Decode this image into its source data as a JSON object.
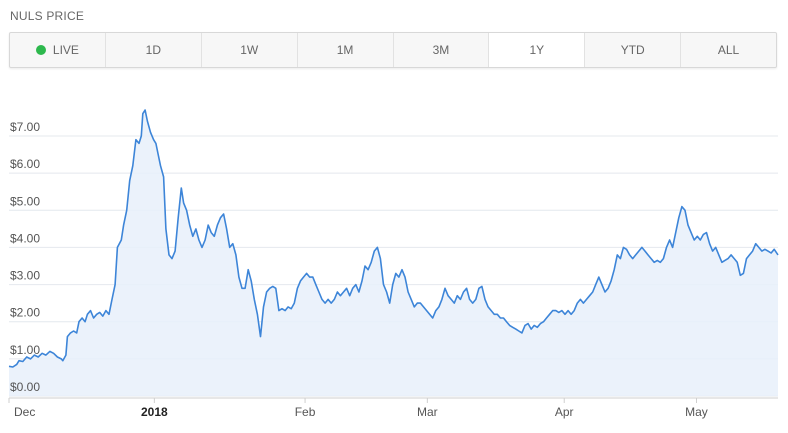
{
  "header": {
    "title": "NULS PRICE"
  },
  "range_buttons": [
    {
      "label": "LIVE",
      "has_dot": true
    },
    {
      "label": "1D"
    },
    {
      "label": "1W"
    },
    {
      "label": "1M"
    },
    {
      "label": "3M"
    },
    {
      "label": "1Y",
      "active": true
    },
    {
      "label": "YTD"
    },
    {
      "label": "ALL"
    }
  ],
  "colors": {
    "live_dot": "#2db84d",
    "line": "#3d85d8",
    "fill": "#e8f0fa",
    "grid": "#e4e8ee",
    "axis": "#cfcfcf"
  },
  "chart_data": {
    "type": "area",
    "title": "",
    "xlabel": "",
    "ylabel": "",
    "ylim": [
      0,
      8
    ],
    "grid": true,
    "yticks": [
      "$0.00",
      "$1.00",
      "$2.00",
      "$3.00",
      "$4.00",
      "$5.00",
      "$6.00",
      "$7.00"
    ],
    "ytick_values": [
      0,
      1,
      2,
      3,
      4,
      5,
      6,
      7
    ],
    "xticks": [
      {
        "label": "Dec",
        "t": 0.0,
        "bold": false
      },
      {
        "label": "2018",
        "t": 0.189,
        "bold": true
      },
      {
        "label": "Feb",
        "t": 0.385,
        "bold": false
      },
      {
        "label": "Mar",
        "t": 0.544,
        "bold": false
      },
      {
        "label": "Apr",
        "t": 0.722,
        "bold": false
      },
      {
        "label": "May",
        "t": 0.894,
        "bold": false
      }
    ],
    "series": [
      {
        "values": [
          [
            0.0,
            0.8
          ],
          [
            0.005,
            0.78
          ],
          [
            0.01,
            0.85
          ],
          [
            0.013,
            0.95
          ],
          [
            0.018,
            0.93
          ],
          [
            0.023,
            1.05
          ],
          [
            0.028,
            1.0
          ],
          [
            0.033,
            1.1
          ],
          [
            0.038,
            1.05
          ],
          [
            0.043,
            1.15
          ],
          [
            0.048,
            1.1
          ],
          [
            0.053,
            1.2
          ],
          [
            0.058,
            1.15
          ],
          [
            0.063,
            1.05
          ],
          [
            0.068,
            1.0
          ],
          [
            0.07,
            0.95
          ],
          [
            0.074,
            1.1
          ],
          [
            0.076,
            1.6
          ],
          [
            0.08,
            1.7
          ],
          [
            0.084,
            1.75
          ],
          [
            0.088,
            1.7
          ],
          [
            0.091,
            2.0
          ],
          [
            0.095,
            2.1
          ],
          [
            0.099,
            2.0
          ],
          [
            0.102,
            2.2
          ],
          [
            0.106,
            2.3
          ],
          [
            0.11,
            2.1
          ],
          [
            0.114,
            2.2
          ],
          [
            0.118,
            2.25
          ],
          [
            0.122,
            2.15
          ],
          [
            0.126,
            2.3
          ],
          [
            0.13,
            2.2
          ],
          [
            0.134,
            2.6
          ],
          [
            0.138,
            3.0
          ],
          [
            0.141,
            4.0
          ],
          [
            0.146,
            4.2
          ],
          [
            0.149,
            4.6
          ],
          [
            0.153,
            5.0
          ],
          [
            0.157,
            5.8
          ],
          [
            0.161,
            6.2
          ],
          [
            0.165,
            6.9
          ],
          [
            0.169,
            6.8
          ],
          [
            0.172,
            7.0
          ],
          [
            0.174,
            7.6
          ],
          [
            0.177,
            7.7
          ],
          [
            0.18,
            7.4
          ],
          [
            0.184,
            7.1
          ],
          [
            0.188,
            6.9
          ],
          [
            0.191,
            6.8
          ],
          [
            0.194,
            6.5
          ],
          [
            0.197,
            6.2
          ],
          [
            0.201,
            5.9
          ],
          [
            0.204,
            4.5
          ],
          [
            0.208,
            3.8
          ],
          [
            0.212,
            3.7
          ],
          [
            0.216,
            3.9
          ],
          [
            0.22,
            4.8
          ],
          [
            0.224,
            5.6
          ],
          [
            0.227,
            5.2
          ],
          [
            0.231,
            5.0
          ],
          [
            0.235,
            4.6
          ],
          [
            0.239,
            4.3
          ],
          [
            0.243,
            4.5
          ],
          [
            0.247,
            4.2
          ],
          [
            0.251,
            4.0
          ],
          [
            0.255,
            4.2
          ],
          [
            0.259,
            4.6
          ],
          [
            0.263,
            4.4
          ],
          [
            0.267,
            4.3
          ],
          [
            0.271,
            4.6
          ],
          [
            0.275,
            4.8
          ],
          [
            0.279,
            4.9
          ],
          [
            0.283,
            4.5
          ],
          [
            0.287,
            4.0
          ],
          [
            0.291,
            4.1
          ],
          [
            0.295,
            3.8
          ],
          [
            0.299,
            3.2
          ],
          [
            0.303,
            2.9
          ],
          [
            0.307,
            2.9
          ],
          [
            0.311,
            3.4
          ],
          [
            0.315,
            3.1
          ],
          [
            0.319,
            2.6
          ],
          [
            0.323,
            2.2
          ],
          [
            0.327,
            1.6
          ],
          [
            0.331,
            2.4
          ],
          [
            0.335,
            2.8
          ],
          [
            0.339,
            2.9
          ],
          [
            0.343,
            2.95
          ],
          [
            0.347,
            2.9
          ],
          [
            0.351,
            2.3
          ],
          [
            0.355,
            2.35
          ],
          [
            0.359,
            2.3
          ],
          [
            0.363,
            2.4
          ],
          [
            0.367,
            2.35
          ],
          [
            0.371,
            2.5
          ],
          [
            0.375,
            2.9
          ],
          [
            0.379,
            3.1
          ],
          [
            0.383,
            3.2
          ],
          [
            0.387,
            3.3
          ],
          [
            0.391,
            3.2
          ],
          [
            0.395,
            3.2
          ],
          [
            0.399,
            3.0
          ],
          [
            0.403,
            2.8
          ],
          [
            0.407,
            2.6
          ],
          [
            0.411,
            2.5
          ],
          [
            0.415,
            2.6
          ],
          [
            0.419,
            2.5
          ],
          [
            0.423,
            2.6
          ],
          [
            0.427,
            2.8
          ],
          [
            0.431,
            2.7
          ],
          [
            0.435,
            2.8
          ],
          [
            0.439,
            2.9
          ],
          [
            0.443,
            2.7
          ],
          [
            0.447,
            2.9
          ],
          [
            0.451,
            3.0
          ],
          [
            0.455,
            2.8
          ],
          [
            0.459,
            3.1
          ],
          [
            0.463,
            3.5
          ],
          [
            0.467,
            3.4
          ],
          [
            0.471,
            3.6
          ],
          [
            0.475,
            3.9
          ],
          [
            0.479,
            4.0
          ],
          [
            0.483,
            3.7
          ],
          [
            0.487,
            3.0
          ],
          [
            0.491,
            2.8
          ],
          [
            0.495,
            2.5
          ],
          [
            0.499,
            3.0
          ],
          [
            0.503,
            3.3
          ],
          [
            0.507,
            3.2
          ],
          [
            0.511,
            3.4
          ],
          [
            0.515,
            3.2
          ],
          [
            0.519,
            2.8
          ],
          [
            0.523,
            2.6
          ],
          [
            0.527,
            2.4
          ],
          [
            0.531,
            2.5
          ],
          [
            0.535,
            2.5
          ],
          [
            0.539,
            2.4
          ],
          [
            0.543,
            2.3
          ],
          [
            0.547,
            2.2
          ],
          [
            0.551,
            2.1
          ],
          [
            0.555,
            2.3
          ],
          [
            0.559,
            2.4
          ],
          [
            0.563,
            2.6
          ],
          [
            0.567,
            2.9
          ],
          [
            0.571,
            2.7
          ],
          [
            0.575,
            2.6
          ],
          [
            0.579,
            2.5
          ],
          [
            0.583,
            2.7
          ],
          [
            0.587,
            2.6
          ],
          [
            0.591,
            2.8
          ],
          [
            0.595,
            2.9
          ],
          [
            0.599,
            2.6
          ],
          [
            0.603,
            2.5
          ],
          [
            0.607,
            2.6
          ],
          [
            0.611,
            2.9
          ],
          [
            0.615,
            2.95
          ],
          [
            0.619,
            2.6
          ],
          [
            0.623,
            2.4
          ],
          [
            0.627,
            2.3
          ],
          [
            0.631,
            2.2
          ],
          [
            0.635,
            2.2
          ],
          [
            0.639,
            2.1
          ],
          [
            0.643,
            2.1
          ],
          [
            0.647,
            2.0
          ],
          [
            0.651,
            1.9
          ],
          [
            0.655,
            1.85
          ],
          [
            0.659,
            1.8
          ],
          [
            0.663,
            1.75
          ],
          [
            0.667,
            1.7
          ],
          [
            0.671,
            1.9
          ],
          [
            0.675,
            1.95
          ],
          [
            0.679,
            1.8
          ],
          [
            0.683,
            1.9
          ],
          [
            0.687,
            1.85
          ],
          [
            0.691,
            1.95
          ],
          [
            0.695,
            2.0
          ],
          [
            0.699,
            2.1
          ],
          [
            0.703,
            2.2
          ],
          [
            0.707,
            2.3
          ],
          [
            0.711,
            2.3
          ],
          [
            0.715,
            2.25
          ],
          [
            0.719,
            2.3
          ],
          [
            0.723,
            2.2
          ],
          [
            0.727,
            2.3
          ],
          [
            0.731,
            2.2
          ],
          [
            0.735,
            2.3
          ],
          [
            0.739,
            2.5
          ],
          [
            0.743,
            2.6
          ],
          [
            0.747,
            2.5
          ],
          [
            0.751,
            2.6
          ],
          [
            0.755,
            2.7
          ],
          [
            0.759,
            2.8
          ],
          [
            0.763,
            3.0
          ],
          [
            0.767,
            3.2
          ],
          [
            0.771,
            3.0
          ],
          [
            0.775,
            2.8
          ],
          [
            0.779,
            2.9
          ],
          [
            0.783,
            3.1
          ],
          [
            0.787,
            3.4
          ],
          [
            0.791,
            3.8
          ],
          [
            0.795,
            3.7
          ],
          [
            0.799,
            4.0
          ],
          [
            0.803,
            3.95
          ],
          [
            0.807,
            3.8
          ],
          [
            0.811,
            3.7
          ],
          [
            0.815,
            3.8
          ],
          [
            0.819,
            3.9
          ],
          [
            0.823,
            4.0
          ],
          [
            0.827,
            3.9
          ],
          [
            0.831,
            3.8
          ],
          [
            0.835,
            3.7
          ],
          [
            0.839,
            3.6
          ],
          [
            0.843,
            3.65
          ],
          [
            0.847,
            3.6
          ],
          [
            0.851,
            3.7
          ],
          [
            0.855,
            4.0
          ],
          [
            0.859,
            4.2
          ],
          [
            0.863,
            4.0
          ],
          [
            0.867,
            4.4
          ],
          [
            0.871,
            4.8
          ],
          [
            0.875,
            5.1
          ],
          [
            0.879,
            5.0
          ],
          [
            0.883,
            4.6
          ],
          [
            0.887,
            4.4
          ],
          [
            0.891,
            4.2
          ],
          [
            0.895,
            4.3
          ],
          [
            0.899,
            4.2
          ],
          [
            0.903,
            4.35
          ],
          [
            0.907,
            4.4
          ],
          [
            0.911,
            4.1
          ],
          [
            0.915,
            3.9
          ],
          [
            0.919,
            4.0
          ],
          [
            0.923,
            3.8
          ],
          [
            0.927,
            3.6
          ],
          [
            0.931,
            3.65
          ],
          [
            0.935,
            3.7
          ],
          [
            0.939,
            3.8
          ],
          [
            0.943,
            3.7
          ],
          [
            0.947,
            3.6
          ],
          [
            0.951,
            3.25
          ],
          [
            0.955,
            3.3
          ],
          [
            0.959,
            3.7
          ],
          [
            0.963,
            3.8
          ],
          [
            0.967,
            3.9
          ],
          [
            0.971,
            4.1
          ],
          [
            0.975,
            4.0
          ],
          [
            0.979,
            3.9
          ],
          [
            0.983,
            3.95
          ],
          [
            0.987,
            3.9
          ],
          [
            0.991,
            3.85
          ],
          [
            0.995,
            3.95
          ],
          [
            1.0,
            3.8
          ]
        ]
      }
    ]
  }
}
